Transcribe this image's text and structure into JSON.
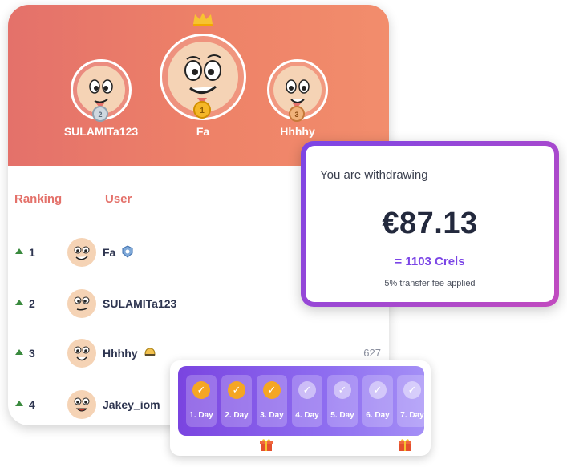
{
  "leaderboard": {
    "podium": {
      "first": {
        "name": "Fa",
        "medal": "1"
      },
      "second": {
        "name": "SULAMITa123",
        "medal": "2"
      },
      "third": {
        "name": "Hhhhy",
        "medal": "3"
      }
    },
    "headers": {
      "ranking": "Ranking",
      "user": "User"
    },
    "rows": [
      {
        "rank": "1",
        "name": "Fa",
        "badge": "shield-badge-icon",
        "score": ""
      },
      {
        "rank": "2",
        "name": "SULAMITa123",
        "badge": "",
        "score": ""
      },
      {
        "rank": "3",
        "name": "Hhhhy",
        "badge": "helmet-badge-icon",
        "score": "627"
      },
      {
        "rank": "4",
        "name": "Jakey_iom",
        "badge": "",
        "score": ""
      }
    ]
  },
  "withdraw": {
    "title": "You are withdrawing",
    "amount": "€87.13",
    "crels": "= 1103 Crels",
    "fee": "5% transfer fee applied"
  },
  "streak": {
    "days": [
      {
        "label": "1. Day",
        "done": true
      },
      {
        "label": "2. Day",
        "done": true
      },
      {
        "label": "3. Day",
        "done": true
      },
      {
        "label": "4. Day",
        "done": false
      },
      {
        "label": "5. Day",
        "done": false
      },
      {
        "label": "6. Day",
        "done": false
      },
      {
        "label": "7. Day",
        "done": false
      }
    ]
  },
  "colors": {
    "accent": "#e4716a",
    "purple": "#7b45e6",
    "gold": "#f5a623"
  }
}
